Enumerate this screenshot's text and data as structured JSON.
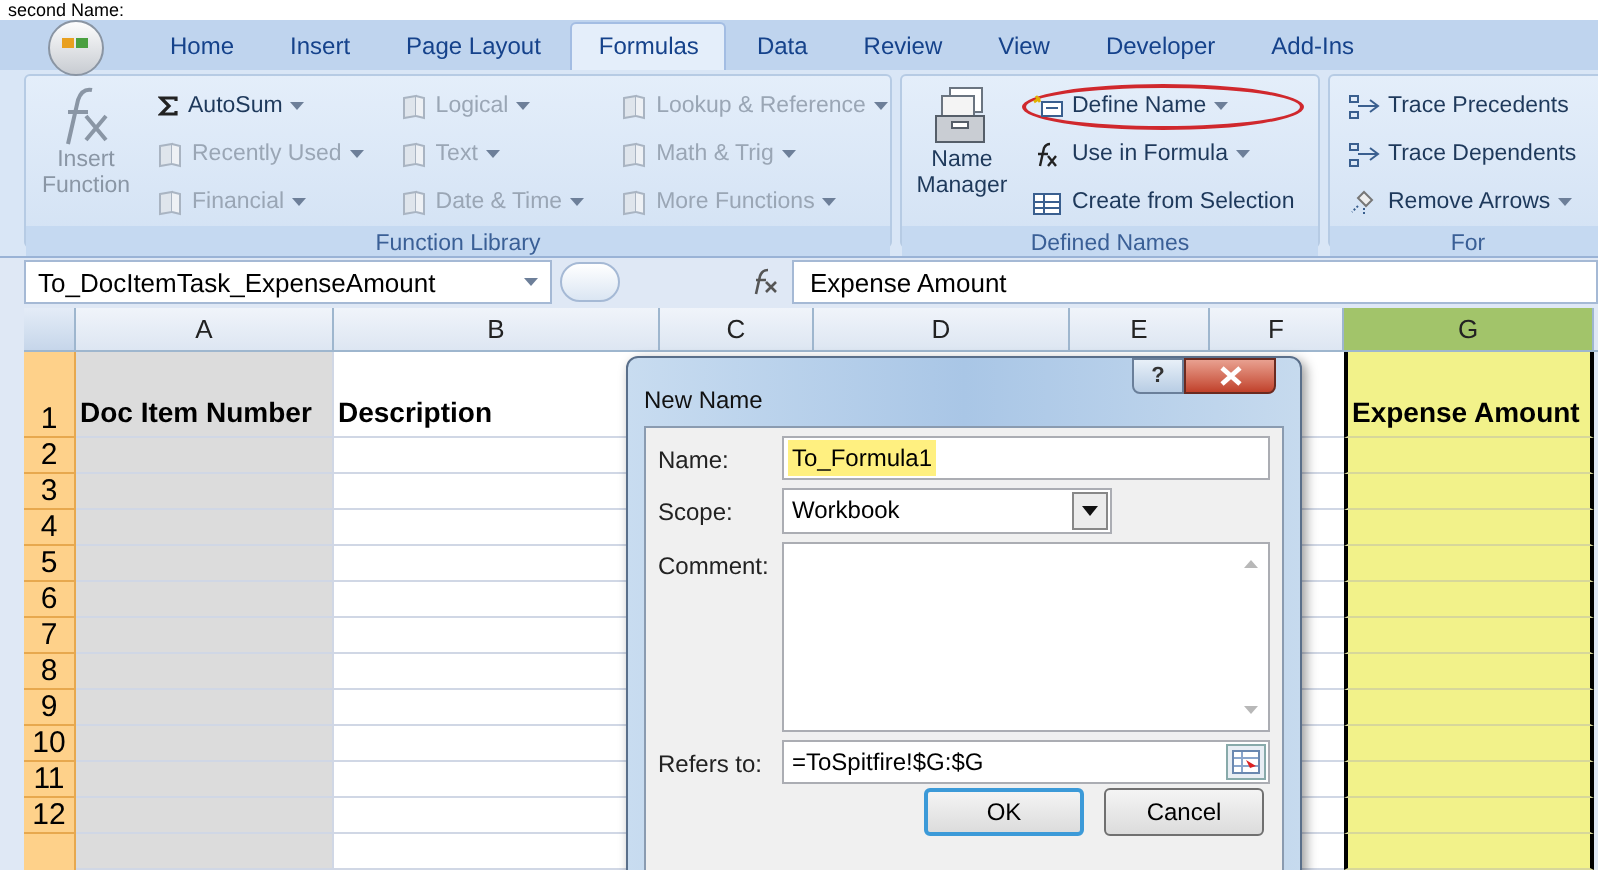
{
  "caption": "second Name:",
  "tabs": [
    {
      "label": "Home",
      "selected": false
    },
    {
      "label": "Insert",
      "selected": false
    },
    {
      "label": "Page Layout",
      "selected": false
    },
    {
      "label": "Formulas",
      "selected": true
    },
    {
      "label": "Data",
      "selected": false
    },
    {
      "label": "Review",
      "selected": false
    },
    {
      "label": "View",
      "selected": false
    },
    {
      "label": "Developer",
      "selected": false
    },
    {
      "label": "Add-Ins",
      "selected": false
    }
  ],
  "ribbon": {
    "groups": [
      {
        "label": "Function Library",
        "large": {
          "label": "Insert Function",
          "disabled": true
        },
        "columns": [
          [
            {
              "label": "AutoSum",
              "dropdown": true,
              "disabled": false,
              "circled": false
            },
            {
              "label": "Recently Used",
              "dropdown": true,
              "disabled": true,
              "circled": false
            },
            {
              "label": "Financial",
              "dropdown": true,
              "disabled": true,
              "circled": false
            }
          ],
          [
            {
              "label": "Logical",
              "dropdown": true,
              "disabled": true,
              "circled": false
            },
            {
              "label": "Text",
              "dropdown": true,
              "disabled": true,
              "circled": false
            },
            {
              "label": "Date & Time",
              "dropdown": true,
              "disabled": true,
              "circled": false
            }
          ],
          [
            {
              "label": "Lookup & Reference",
              "dropdown": true,
              "disabled": true,
              "circled": false
            },
            {
              "label": "Math & Trig",
              "dropdown": true,
              "disabled": true,
              "circled": false
            },
            {
              "label": "More Functions",
              "dropdown": true,
              "disabled": true,
              "circled": false
            }
          ]
        ]
      },
      {
        "label": "Defined Names",
        "large": {
          "label": "Name Manager",
          "disabled": false
        },
        "columns": [
          [
            {
              "label": "Define Name",
              "dropdown": true,
              "disabled": false,
              "circled": true
            },
            {
              "label": "Use in Formula",
              "dropdown": true,
              "disabled": false,
              "circled": false
            },
            {
              "label": "Create from Selection",
              "dropdown": false,
              "disabled": false,
              "circled": false
            }
          ]
        ]
      },
      {
        "label": "For",
        "columns": [
          [
            {
              "label": "Trace Precedents",
              "dropdown": false,
              "disabled": false,
              "circled": false
            },
            {
              "label": "Trace Dependents",
              "dropdown": false,
              "disabled": false,
              "circled": false
            },
            {
              "label": "Remove Arrows",
              "dropdown": true,
              "disabled": false,
              "circled": false
            }
          ]
        ]
      }
    ]
  },
  "sheet": {
    "name_box": "To_DocItemTask_ExpenseAmount",
    "formula": "Expense Amount",
    "columns": [
      {
        "label": "A",
        "selected": false
      },
      {
        "label": "B",
        "selected": false
      },
      {
        "label": "C",
        "selected": false
      },
      {
        "label": "D",
        "selected": false
      },
      {
        "label": "E",
        "selected": false
      },
      {
        "label": "F",
        "selected": false
      },
      {
        "label": "G",
        "selected": true
      }
    ],
    "rows": [
      {
        "label": "1",
        "cells": {
          "A": "Doc Item Number",
          "B": "Description",
          "G": "Expense Amount"
        }
      },
      {
        "label": "2"
      },
      {
        "label": "3"
      },
      {
        "label": "4"
      },
      {
        "label": "5"
      },
      {
        "label": "6"
      },
      {
        "label": "7"
      },
      {
        "label": "8"
      },
      {
        "label": "9"
      },
      {
        "label": "10"
      },
      {
        "label": "11"
      },
      {
        "label": "12"
      }
    ]
  },
  "dialog": {
    "title": "New Name",
    "help": "?",
    "fields": [
      {
        "kind": "text",
        "label": "Name:",
        "value": "To_Formula1",
        "highlighted": true
      },
      {
        "kind": "select",
        "label": "Scope:",
        "value": "Workbook"
      },
      {
        "kind": "textarea",
        "label": "Comment:"
      },
      {
        "kind": "range",
        "label": "Refers to:",
        "value": "=ToSpitfire!$G:$G"
      }
    ],
    "buttons": [
      {
        "label": "OK",
        "default": true
      },
      {
        "label": "Cancel",
        "default": false
      }
    ]
  }
}
